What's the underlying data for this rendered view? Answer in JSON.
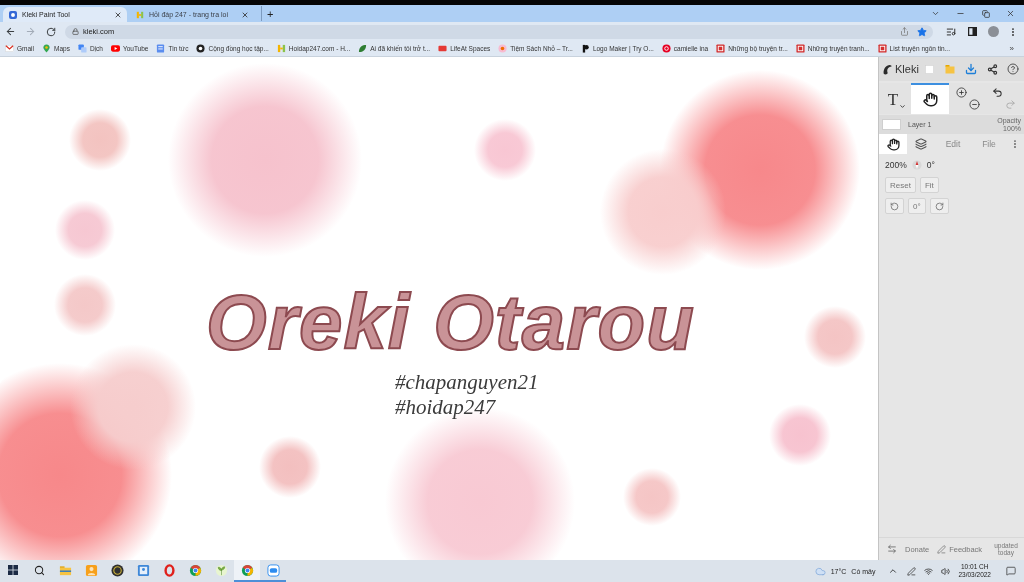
{
  "browser": {
    "tabs": [
      {
        "title": "Kleki Paint Tool",
        "selected": true
      },
      {
        "title": "Hỏi đáp 247 - trang tra loi",
        "selected": false
      }
    ],
    "new_tab": "+",
    "nav": [
      {
        "kind": "back",
        "disabled": false
      },
      {
        "kind": "forward",
        "disabled": true
      },
      {
        "kind": "reload",
        "disabled": false
      }
    ],
    "address": "kleki.com",
    "bookmarked": true,
    "bookmarks": [
      "Gmail",
      "Maps",
      "Dịch",
      "YouTube",
      "Tin tức",
      "Cộng đồng học tập...",
      "Hoidap247.com - H...",
      "Ai đã khiến tôi trở t...",
      "LifeAt Spaces",
      "Tiệm Sách Nhỏ – Tr...",
      "Logo Maker | Try O...",
      "camielle ina",
      "Những bộ truyện tr...",
      "Những truyện tranh...",
      "List truyện ngôn tin..."
    ],
    "more_bookmarks": "»"
  },
  "canvas": {
    "title": "Oreki Otarou",
    "tags": [
      "#chapanguyen21",
      "#hoidap247"
    ]
  },
  "kleki": {
    "logo": "Kleki",
    "tools": [
      {
        "kind": "text",
        "label": "T",
        "selected": false
      },
      {
        "kind": "hand",
        "selected": true
      }
    ],
    "layer": {
      "name": "Layer 1",
      "opacity_label": "Opacity",
      "opacity": "100%"
    },
    "tabs": [
      {
        "kind": "hand",
        "selected": true
      },
      {
        "kind": "layers",
        "selected": false
      },
      {
        "kind": "label",
        "label": "Edit",
        "selected": false
      },
      {
        "kind": "label",
        "label": "File",
        "selected": false
      }
    ],
    "zoom": "200%",
    "angle": "0°",
    "view_buttons": [
      "Reset",
      "Fit"
    ],
    "rotate_value": "0°",
    "footer": {
      "donate": "Donate",
      "feedback": "Feedback",
      "updated": "updated today"
    }
  },
  "taskbar": {
    "apps": [
      {
        "open": false,
        "selected": false
      },
      {
        "open": false,
        "selected": false
      },
      {
        "open": false,
        "selected": false
      },
      {
        "open": false,
        "selected": false
      },
      {
        "open": false,
        "selected": false
      },
      {
        "open": false,
        "selected": false
      },
      {
        "open": false,
        "selected": false
      },
      {
        "open": true,
        "selected": true
      },
      {
        "open": true,
        "selected": false
      }
    ],
    "temperature": "17°C",
    "weather": "Có mây",
    "time": "10:01 CH",
    "date": "23/03/2022"
  }
}
